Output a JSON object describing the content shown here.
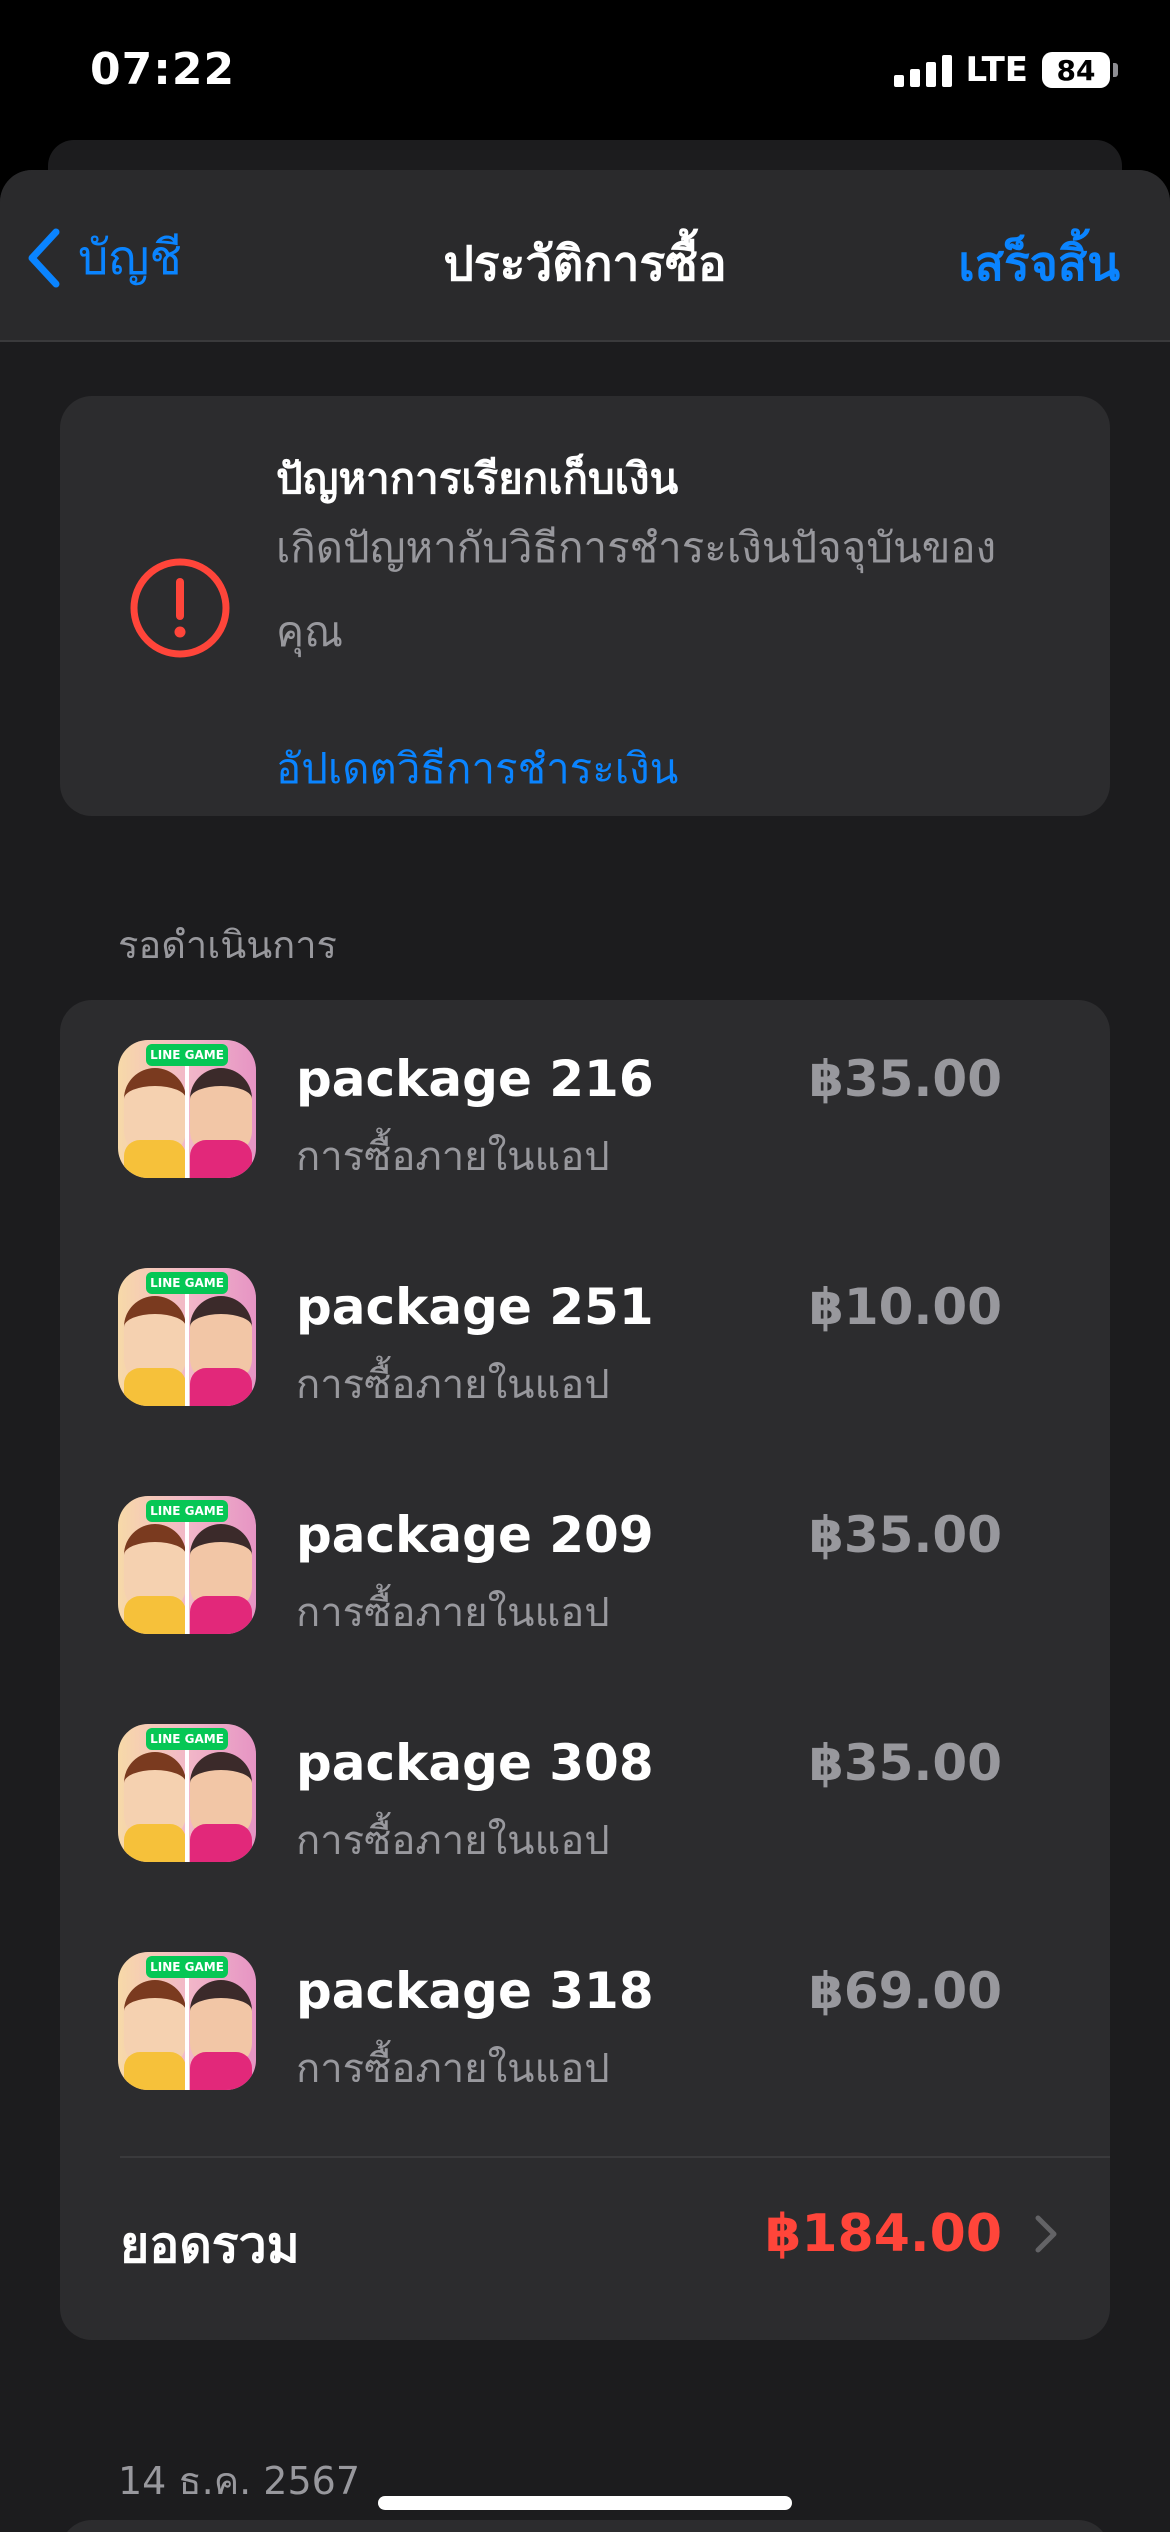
{
  "status_bar": {
    "time": "07:22",
    "network": "LTE",
    "battery": "84"
  },
  "nav": {
    "back_label": "บัญชี",
    "title": "ประวัติการซื้อ",
    "done_label": "เสร็จสิ้น"
  },
  "alert": {
    "title": "ปัญหาการเรียกเก็บเงิน",
    "description": "เกิดปัญหากับวิธีการชำระเงินปัจจุบันของคุณ",
    "link": "อัปเดตวิธีการชำระเงิน",
    "icon": "exclamation-circle-icon",
    "color": "#ff453a"
  },
  "pending": {
    "label": "รอดำเนินการ",
    "items": [
      {
        "name": "package 216",
        "type": "การซื้อภายในแอป",
        "price": "฿35.00",
        "badge": "LINE GAME"
      },
      {
        "name": "package 251",
        "type": "การซื้อภายในแอป",
        "price": "฿10.00",
        "badge": "LINE GAME"
      },
      {
        "name": "package 209",
        "type": "การซื้อภายในแอป",
        "price": "฿35.00",
        "badge": "LINE GAME"
      },
      {
        "name": "package 308",
        "type": "การซื้อภายในแอป",
        "price": "฿35.00",
        "badge": "LINE GAME"
      },
      {
        "name": "package 318",
        "type": "การซื้อภายในแอป",
        "price": "฿69.00",
        "badge": "LINE GAME"
      }
    ],
    "total_label": "ยอดรวม",
    "total_value": "฿184.00"
  },
  "next_section": {
    "date": "14 ธ.ค. 2567"
  },
  "colors": {
    "accent": "#0a84ff",
    "danger": "#ff453a",
    "background": "#1c1c1e",
    "card": "#2c2c2e"
  }
}
